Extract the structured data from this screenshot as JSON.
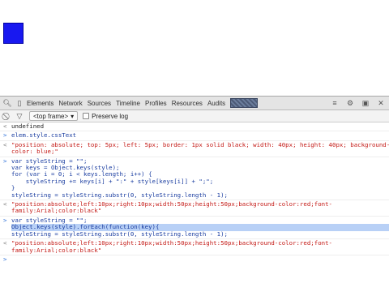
{
  "devtools": {
    "tabs": [
      "Elements",
      "Network",
      "Sources",
      "Timeline",
      "Profiles",
      "Resources",
      "Audits"
    ],
    "selected_tab": "Console",
    "frame_select": "<top frame>",
    "preserve_log_label": "Preserve log"
  },
  "console": {
    "lines": [
      {
        "kind": "output",
        "text": "undefined"
      },
      {
        "kind": "input",
        "text": "elem.style.cssText"
      },
      {
        "kind": "result",
        "text": "\"position: absolute; top: 5px; left: 5px; border: 1px solid black; width: 40px; height: 40px; background-"
      },
      {
        "kind": "result-cont",
        "text": "color: blue;\""
      },
      {
        "kind": "input",
        "text": "var styleString = \"\";"
      },
      {
        "kind": "code",
        "text": "var keys = Object.keys(style);"
      },
      {
        "kind": "code",
        "text": "for (var i = 0; i < keys.length; i++) {"
      },
      {
        "kind": "code",
        "text": "    styleString += keys[i] + \":\" + style[keys[i]] + \";\";"
      },
      {
        "kind": "code",
        "text": "}"
      },
      {
        "kind": "code",
        "text": "styleString = styleString.substr(0, styleString.length - 1);"
      },
      {
        "kind": "result",
        "text": "\"position:absolute;left:10px;right:10px;width:50px;height:50px;background-color:red;font-"
      },
      {
        "kind": "result-cont",
        "text": "family:Arial;color:black\""
      },
      {
        "kind": "input",
        "text": "var styleString = \"\";"
      },
      {
        "kind": "highlight",
        "text": "Object.keys(style).forEach(function(key){"
      },
      {
        "kind": "highlight",
        "text": "    styleString += key + \":\" + style[key] + \";\";"
      },
      {
        "kind": "highlight",
        "text": "});"
      },
      {
        "kind": "code",
        "text": "styleString = styleString.substr(0, styleString.length - 1);"
      },
      {
        "kind": "result",
        "text": "\"position:absolute;left:10px;right:10px;width:50px;height:50px;background-color:red;font-"
      },
      {
        "kind": "result-cont",
        "text": "family:Arial;color:black\""
      }
    ]
  },
  "colors": {
    "blue_box": "#1818f0",
    "selection": "#b8d0f6",
    "string": "#c41a16"
  }
}
